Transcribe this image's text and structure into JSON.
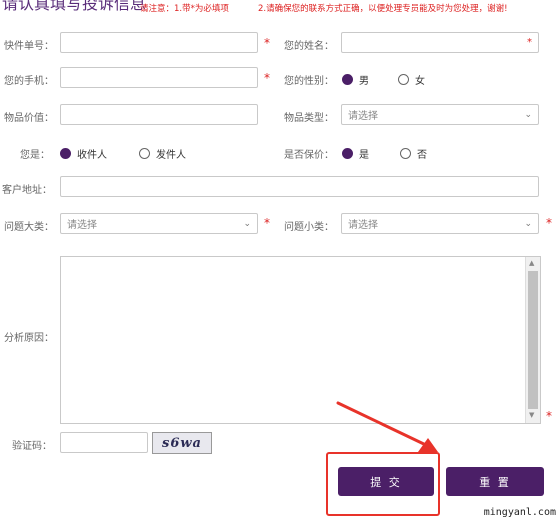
{
  "header": {
    "title": "请认真填写投诉信息",
    "notice1": "请注意：1.带*为必填项",
    "notice2": "2.请确保您的联系方式正确，以便处理专员能及时为您处理，谢谢!"
  },
  "form": {
    "express_no_label": "快件单号：",
    "name_label": "您的姓名：",
    "phone_label": "您的手机：",
    "gender_label": "您的性别：",
    "gender_male": "男",
    "gender_female": "女",
    "value_label": "物品价值：",
    "type_label": "物品类型：",
    "type_placeholder": "请选择",
    "role_label": "您是：",
    "role_receiver": "收件人",
    "role_sender": "发件人",
    "insured_label": "是否保价：",
    "insured_yes": "是",
    "insured_no": "否",
    "address_label": "客户地址：",
    "category_label": "问题大类：",
    "category_placeholder": "请选择",
    "subcategory_label": "问题小类：",
    "subcategory_placeholder": "请选择",
    "reason_label": "分析原因：",
    "captcha_label": "验证码：",
    "captcha_text": "s6wa",
    "required_mark": "*"
  },
  "buttons": {
    "submit": "提 交",
    "reset": "重 置"
  },
  "watermark": "mingyanl.com",
  "colors": {
    "brand": "#4b1f67",
    "required": "#dd2222",
    "highlight": "#e8332a"
  }
}
